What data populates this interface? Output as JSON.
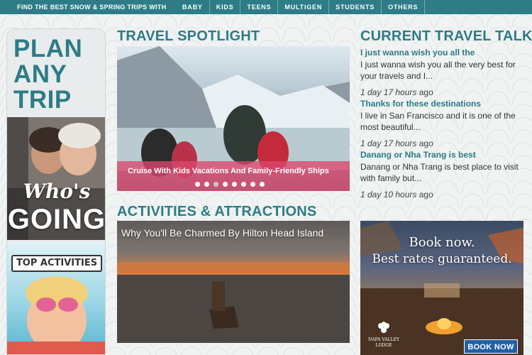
{
  "topbar": {
    "title": "FIND THE BEST SNOW & SPRING TRIPS WITH",
    "links": [
      "BABY",
      "KIDS",
      "TEENS",
      "MULTIGEN",
      "STUDENTS",
      "OTHERS"
    ]
  },
  "left": {
    "plan_lines": [
      "PLAN",
      "ANY",
      "TRIP"
    ],
    "whos_line1": "Who's",
    "whos_line2": "GOING",
    "top_activities": "TOP ACTIVITIES"
  },
  "spotlight": {
    "heading": "TRAVEL SPOTLIGHT",
    "caption": "Cruise With Kids Vacations And Family-Friendly Ships",
    "dots_count": 8,
    "active_dot": 2
  },
  "activities": {
    "heading": "ACTIVITIES & ATTRACTIONS",
    "caption": "Why You'll Be Charmed By Hilton Head Island"
  },
  "talk": {
    "heading": "CURRENT TRAVEL TALK",
    "items": [
      {
        "title": "I just wanna wish you all the",
        "body": "I just wanna wish you all the very best for your travels and I...",
        "time": "1 day 17 hours",
        "ago": "ago"
      },
      {
        "title": "Thanks for these destinations",
        "body": "I live in San Francisco and it is one of the most beautiful...",
        "time": "1 day 17 hours",
        "ago": "ago"
      },
      {
        "title": "Danang or Nha Trang is best",
        "body": "Danang or Nha Trang is best place to visit with family but...",
        "time": "1 day 10 hours",
        "ago": "ago"
      }
    ]
  },
  "ad": {
    "headline1": "Book now.",
    "headline2": "Best rates guaranteed.",
    "logo_line1": "NAPA VALLEY",
    "logo_line2": "LODGE",
    "button": "BOOK NOW"
  },
  "colors": {
    "brand_teal": "#2d7c86",
    "caption_pink": "#dc466e",
    "ad_button_blue": "#1f5fa8"
  }
}
